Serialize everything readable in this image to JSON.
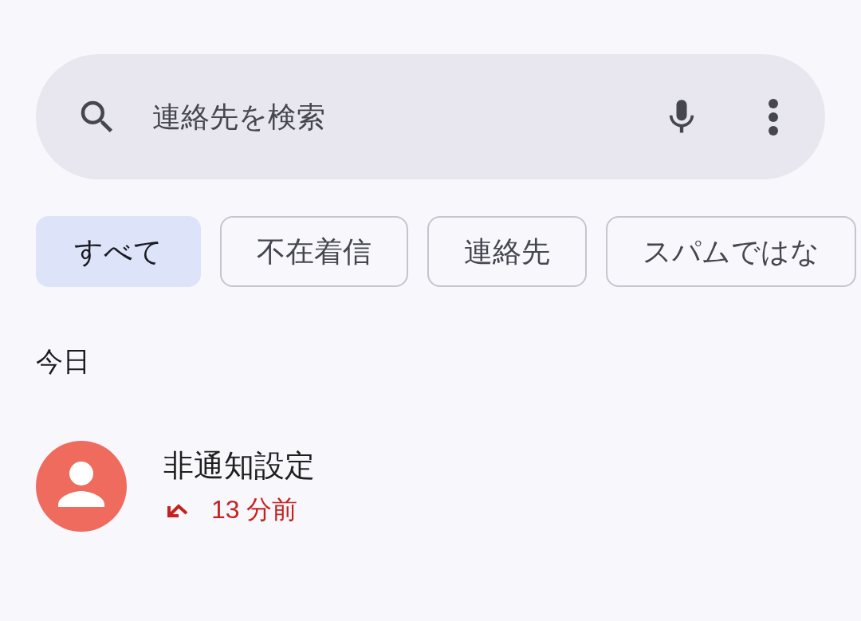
{
  "search": {
    "placeholder": "連絡先を検索"
  },
  "filters": [
    {
      "label": "すべて",
      "selected": true
    },
    {
      "label": "不在着信",
      "selected": false
    },
    {
      "label": "連絡先",
      "selected": false
    },
    {
      "label": "スパムではな",
      "selected": false
    }
  ],
  "sections": [
    {
      "title": "今日",
      "calls": [
        {
          "name": "非通知設定",
          "missed": true,
          "time": "13 分前",
          "color": "#ee6b5e"
        }
      ]
    }
  ]
}
